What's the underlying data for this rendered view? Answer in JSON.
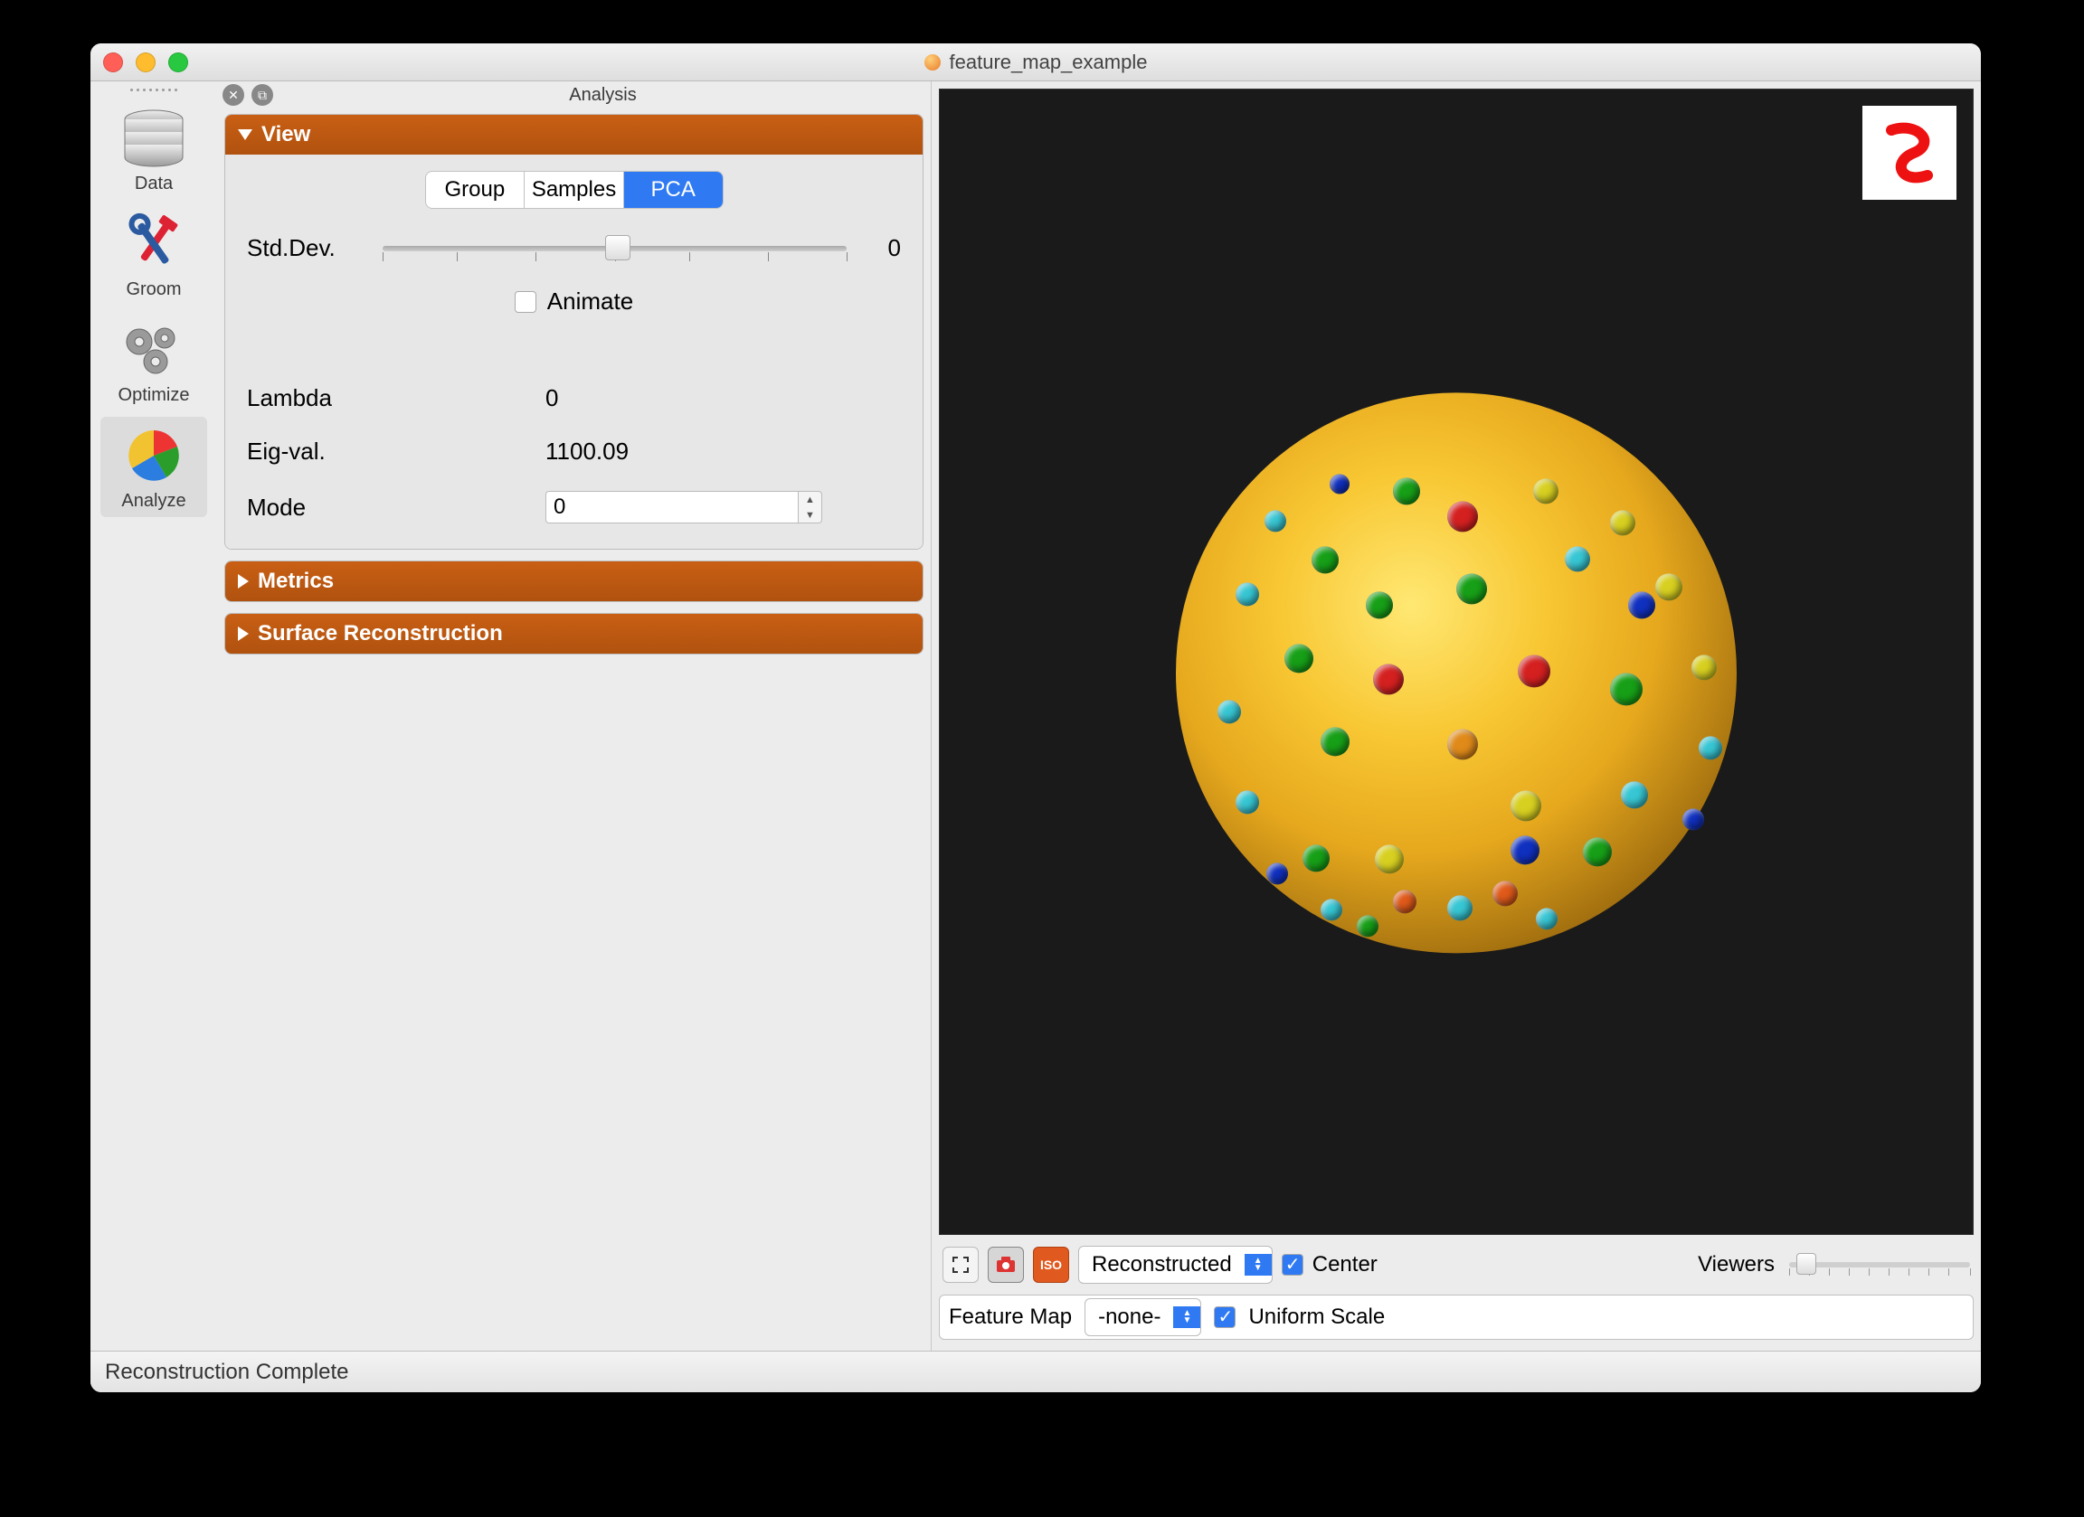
{
  "window": {
    "title": "feature_map_example"
  },
  "sidebar": {
    "items": [
      {
        "label": "Data"
      },
      {
        "label": "Groom"
      },
      {
        "label": "Optimize"
      },
      {
        "label": "Analyze"
      }
    ],
    "active": "Analyze"
  },
  "panel": {
    "title": "Analysis",
    "sections": {
      "view": {
        "title": "View",
        "tabs": [
          "Group",
          "Samples",
          "PCA"
        ],
        "active_tab": "PCA",
        "stddev_label": "Std.Dev.",
        "stddev_value": "0",
        "animate_label": "Animate",
        "animate_checked": false,
        "lambda_label": "Lambda",
        "lambda_value": "0",
        "eigval_label": "Eig-val.",
        "eigval_value": "1100.09",
        "mode_label": "Mode",
        "mode_value": "0"
      },
      "metrics": {
        "title": "Metrics"
      },
      "surface": {
        "title": "Surface Reconstruction"
      }
    }
  },
  "viewer": {
    "toolbar": {
      "view_mode": "Reconstructed",
      "center_label": "Center",
      "center_checked": true,
      "viewers_label": "Viewers"
    },
    "options": {
      "feature_map_label": "Feature Map",
      "feature_map_value": "-none-",
      "uniform_scale_label": "Uniform Scale",
      "uniform_scale_checked": true
    }
  },
  "status": {
    "message": "Reconstruction Complete"
  },
  "colors": {
    "accent": "#c05a13",
    "blue": "#2f7af3"
  }
}
